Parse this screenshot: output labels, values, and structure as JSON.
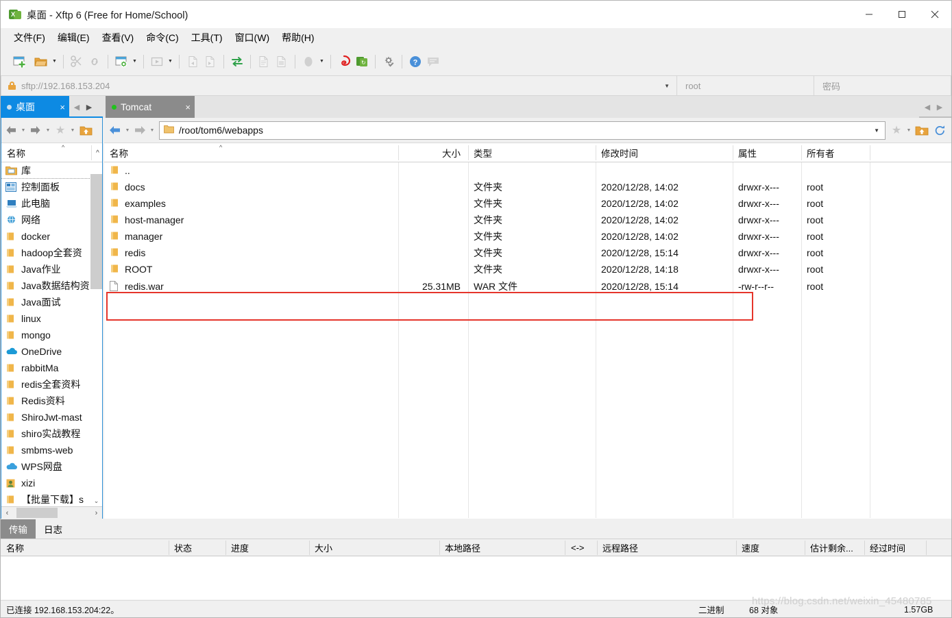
{
  "window": {
    "title": "桌面 - Xftp 6 (Free for Home/School)",
    "app_icon": "xftp-icon",
    "minimize": "minimize-button",
    "maximize": "maximize-button",
    "close": "close-button"
  },
  "menubar": {
    "items": [
      {
        "label": "文件(F)"
      },
      {
        "label": "编辑(E)"
      },
      {
        "label": "查看(V)"
      },
      {
        "label": "命令(C)"
      },
      {
        "label": "工具(T)"
      },
      {
        "label": "窗口(W)"
      },
      {
        "label": "帮助(H)"
      }
    ]
  },
  "toolbar": {
    "buttons": [
      {
        "name": "new-session-icon",
        "enabled": true
      },
      {
        "name": "open-folder-icon",
        "enabled": true,
        "caret": true
      },
      {
        "name": "cut-link-icon",
        "enabled": false
      },
      {
        "name": "link-icon",
        "enabled": false
      },
      {
        "name": "session-settings-icon",
        "enabled": true,
        "caret": true
      },
      {
        "name": "run-icon",
        "enabled": false,
        "caret": true
      },
      {
        "name": "transfer-left-icon",
        "enabled": false
      },
      {
        "name": "transfer-right-icon",
        "enabled": false
      },
      {
        "name": "sync-transfer-icon",
        "enabled": true
      },
      {
        "name": "copy-file-icon",
        "enabled": false
      },
      {
        "name": "paste-file-icon",
        "enabled": false
      },
      {
        "name": "mode-icon",
        "enabled": false,
        "caret": true
      },
      {
        "name": "xshell-icon",
        "enabled": true
      },
      {
        "name": "xftp-icon",
        "enabled": true
      },
      {
        "name": "options-gear-icon",
        "enabled": true
      },
      {
        "name": "help-icon",
        "enabled": true
      },
      {
        "name": "feedback-icon",
        "enabled": false
      }
    ]
  },
  "session_bar": {
    "lock_icon": "lock-icon",
    "url": "sftp://192.168.153.204",
    "url_placeholder": "sftp://",
    "dropdown_icon": "chevron-down-icon",
    "username": "root",
    "username_placeholder": "root",
    "password": "",
    "password_placeholder": "密码"
  },
  "tabs": {
    "local": {
      "label": "桌面",
      "status_dot": "#c8dff0",
      "close": "×"
    },
    "remote": {
      "label": "Tomcat",
      "status_dot": "#21c21d",
      "close": "×"
    },
    "nav_left": "‹",
    "nav_right": "›"
  },
  "local_pane": {
    "nav": {
      "back": "back-arrow-icon",
      "forward": "forward-arrow-icon",
      "favorites": "star-icon",
      "up": "up-folder-icon"
    },
    "column_header": "名称",
    "sort_mark": "^",
    "items": [
      {
        "label": "库",
        "icon": "library-icon",
        "separator": true
      },
      {
        "label": "控制面板",
        "icon": "control-panel-icon"
      },
      {
        "label": "此电脑",
        "icon": "computer-icon"
      },
      {
        "label": "网络",
        "icon": "network-icon"
      },
      {
        "label": "docker",
        "icon": "folder-icon"
      },
      {
        "label": "hadoop全套资",
        "icon": "folder-icon"
      },
      {
        "label": "Java作业",
        "icon": "folder-icon"
      },
      {
        "label": "Java数据结构资",
        "icon": "folder-icon"
      },
      {
        "label": "Java面试",
        "icon": "folder-icon"
      },
      {
        "label": "linux",
        "icon": "folder-icon"
      },
      {
        "label": "mongo",
        "icon": "folder-icon"
      },
      {
        "label": "OneDrive",
        "icon": "onedrive-icon"
      },
      {
        "label": "rabbitMa",
        "icon": "folder-icon"
      },
      {
        "label": "redis全套资料",
        "icon": "folder-icon"
      },
      {
        "label": "Redis资料",
        "icon": "folder-icon"
      },
      {
        "label": "ShiroJwt-mast",
        "icon": "folder-icon"
      },
      {
        "label": "shiro实战教程",
        "icon": "folder-icon"
      },
      {
        "label": "smbms-web",
        "icon": "folder-icon"
      },
      {
        "label": "WPS网盘",
        "icon": "wps-cloud-icon"
      },
      {
        "label": "xizi",
        "icon": "user-icon"
      },
      {
        "label": "【批量下载】s",
        "icon": "folder-icon"
      }
    ],
    "scroll": {
      "up": "▲",
      "down": "▼",
      "left": "‹",
      "right": "›"
    }
  },
  "remote_pane": {
    "nav": {
      "back": "back-arrow-icon",
      "forward": "forward-arrow-icon",
      "favorites": "star-icon",
      "up": "up-folder-icon",
      "refresh": "refresh-icon"
    },
    "path": "/root/tom6/webapps",
    "path_folder_icon": "folder-icon",
    "path_caret": "chevron-down-icon",
    "columns": [
      "名称",
      "大小",
      "类型",
      "修改时间",
      "属性",
      "所有者"
    ],
    "sort_mark": "^",
    "rows": [
      {
        "name": "..",
        "icon": "folder-up-icon",
        "size": "",
        "type": "",
        "modified": "",
        "attrs": "",
        "owner": ""
      },
      {
        "name": "docs",
        "icon": "folder-icon",
        "size": "",
        "type": "文件夹",
        "modified": "2020/12/28, 14:02",
        "attrs": "drwxr-x---",
        "owner": "root"
      },
      {
        "name": "examples",
        "icon": "folder-icon",
        "size": "",
        "type": "文件夹",
        "modified": "2020/12/28, 14:02",
        "attrs": "drwxr-x---",
        "owner": "root"
      },
      {
        "name": "host-manager",
        "icon": "folder-icon",
        "size": "",
        "type": "文件夹",
        "modified": "2020/12/28, 14:02",
        "attrs": "drwxr-x---",
        "owner": "root"
      },
      {
        "name": "manager",
        "icon": "folder-icon",
        "size": "",
        "type": "文件夹",
        "modified": "2020/12/28, 14:02",
        "attrs": "drwxr-x---",
        "owner": "root"
      },
      {
        "name": "redis",
        "icon": "folder-icon",
        "size": "",
        "type": "文件夹",
        "modified": "2020/12/28, 15:14",
        "attrs": "drwxr-x---",
        "owner": "root"
      },
      {
        "name": "ROOT",
        "icon": "folder-icon",
        "size": "",
        "type": "文件夹",
        "modified": "2020/12/28, 14:18",
        "attrs": "drwxr-x---",
        "owner": "root"
      },
      {
        "name": "redis.war",
        "icon": "file-icon",
        "size": "25.31MB",
        "type": "WAR 文件",
        "modified": "2020/12/28, 15:14",
        "attrs": "-rw-r--r--",
        "owner": "root"
      }
    ],
    "highlight_color": "#e5352b"
  },
  "transfer_panel": {
    "tabs": [
      {
        "label": "传输",
        "active": true
      },
      {
        "label": "日志",
        "active": false
      }
    ],
    "columns": [
      "名称",
      "状态",
      "进度",
      "大小",
      "本地路径",
      "<->",
      "远程路径",
      "速度",
      "估计剩余...",
      "经过时间"
    ],
    "rows": []
  },
  "statusbar": {
    "connection": "已连接 192.168.153.204:22。",
    "mode": "二进制",
    "object_count": "68 对象",
    "total_size": "1.57GB"
  },
  "watermark": "https://blog.csdn.net/weixin_45480785"
}
